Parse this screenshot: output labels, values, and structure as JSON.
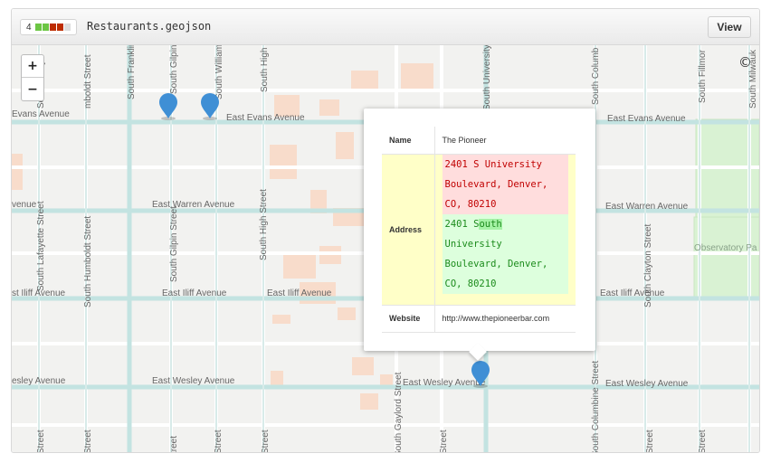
{
  "header": {
    "diff_count": "4",
    "diff_colors": [
      "#6cc644",
      "#6cc644",
      "#bd2c00",
      "#bd2c00",
      "#dddddd"
    ],
    "filename": "Restaurants.geojson",
    "view_label": "View"
  },
  "map": {
    "zoom_in_label": "+",
    "zoom_out_label": "−",
    "attribution": "©",
    "streets_horizontal": [
      "Evans Avenue",
      "East Evans Avenue",
      "East Evans Avenue",
      "venue",
      "East Warren Avenue",
      "East Warren Avenue",
      "st Iliff Avenue",
      "East Iliff Avenue",
      "East Iliff Avenue",
      "East Iliff Avenue",
      "esley Avenue",
      "East Wesley Avenue",
      "East Wesley Avenue",
      "East Wesley Avenue"
    ],
    "streets_vertical": [
      "South Lafayette Street",
      "South Humboldt Street",
      "South Gilpin Street",
      "South High Street",
      "South Clayton Street",
      "South Columbine Street",
      "South Gaylord Street",
      "South Franklin",
      "South Gilpin",
      "South William",
      "South High",
      "South University",
      "South Columb",
      "South Fillmor",
      "South Milwauk",
      "South Lafaye",
      "mboldt Street",
      "Street",
      "Street",
      "treet",
      "Street",
      "Street",
      "Street",
      "Street",
      "Street"
    ],
    "park_label": "Observatory Pa"
  },
  "popup": {
    "name_key": "Name",
    "name_value": "The Pioneer",
    "address_key": "Address",
    "address_deleted": [
      "2401 S University",
      "Boulevard, Denver,",
      "CO, 80210"
    ],
    "address_added_line1_prefix": "2401 S",
    "address_added_line1_highlight": "outh",
    "address_added_rest": [
      "University",
      "Boulevard, Denver,",
      "CO, 80210"
    ],
    "website_key": "Website",
    "website_value": "http://www.thepioneerbar.com"
  }
}
